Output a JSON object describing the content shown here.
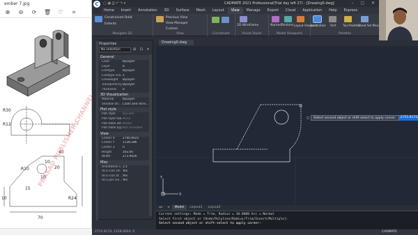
{
  "viewer": {
    "title": "ember 7.jpg",
    "watermark": "PRASAD PUBLISHER CHANNEL",
    "dims": {
      "R30": "R30",
      "R12": "R12",
      "d40": "40",
      "d10a": "10",
      "d20": "20",
      "d10b": "10",
      "R10": "R10",
      "d15": "15",
      "d70": "70",
      "R24": "R24",
      "d10c": "10"
    }
  },
  "app": {
    "logo": "C",
    "title": "CADMATE 2021 Professional(Trial day left 27) - [Drawing0.dwg]",
    "menus": [
      "Home",
      "Insert",
      "Annotation",
      "3D",
      "Surface",
      "Mesh",
      "Layout",
      "View",
      "Manage",
      "Export",
      "Cloud",
      "Application",
      "Help",
      "Express"
    ],
    "active_menu": "View",
    "ribbon": {
      "g1": {
        "item1": "Constrained Orbit",
        "item2": "Extents",
        "name": "Navigate 2D"
      },
      "g2": {
        "item1": "Previous View",
        "item2": "View Manager",
        "item3": "Custom",
        "name": "View"
      },
      "g3": {
        "name": "Coordinate"
      },
      "g4": {
        "item1": "2D Wireframe",
        "name": "Visual Styles"
      },
      "g5": {
        "item1": "Named",
        "item2": "Restore",
        "item3": "Layout Viewport",
        "name": "Model Viewports"
      },
      "g6": {
        "item1": "Annotation",
        "item2": "Xref",
        "item3": "Tool Palettes",
        "item4": "Sheet Set Manager",
        "name": "Palettes"
      }
    }
  },
  "properties": {
    "header": "Properties",
    "selection": "No selection",
    "sections": [
      {
        "title": "General",
        "rows": [
          [
            "Color",
            "ByLayer"
          ],
          [
            "Layer",
            "0"
          ],
          [
            "Linetype",
            "ByLayer"
          ],
          [
            "Linetype sca...",
            "1"
          ],
          [
            "Lineweight",
            "ByLayer"
          ],
          [
            "Transparency",
            "ByLayer"
          ],
          [
            "Thickness",
            "0"
          ]
        ]
      },
      {
        "title": "3D Visualization",
        "rows": [
          [
            "Material",
            "ByLayer"
          ],
          [
            "Shadow dis...",
            "Casts and recei..."
          ]
        ]
      },
      {
        "title": "Plot style",
        "rows": [
          [
            "Plot style",
            "ByColor"
          ],
          [
            "Plot style tab...",
            "None"
          ],
          [
            "Plot table att...",
            "Model"
          ],
          [
            "Plot table typ...",
            "Not available"
          ]
        ]
      },
      {
        "title": "View",
        "rows": [
          [
            "Center X",
            "2700.9025"
          ],
          [
            "Center Y",
            "1138.286"
          ],
          [
            "Center Z",
            "0"
          ],
          [
            "Height",
            "163.00"
          ],
          [
            "Width",
            "273.0926"
          ]
        ]
      },
      {
        "title": "Misc",
        "rows": [
          [
            "Annotation s...",
            "1:1"
          ],
          [
            "UCS icon On",
            "Yes"
          ],
          [
            "UCS icon at ...",
            "Yes"
          ],
          [
            "UCS per vie...",
            "Yes"
          ]
        ]
      }
    ]
  },
  "document": {
    "tab": "Drawing0.dwg",
    "layout_tabs": [
      "Model",
      "Layout1",
      "Layout2"
    ],
    "active_layout": "Model"
  },
  "tooltip": {
    "text": "Select second object or shift-select to apply corner:",
    "value": "2715.8174, 1228.0624"
  },
  "command": {
    "lines": [
      "Current settings: Mode = Trim, Radius = 10.0000 Arc = Normal",
      "Select first object or [Undo/Polyline/Radius/Trim/Insert/Multiple]:"
    ],
    "prompt": "Select second object or shift-select to apply corner:"
  },
  "status": {
    "coords": "2715.8174, 1228.0624, 0",
    "brand": "CADMATE"
  },
  "icons": [
    "search-icon",
    "gear-icon",
    "close-icon",
    "webcam-feed"
  ]
}
